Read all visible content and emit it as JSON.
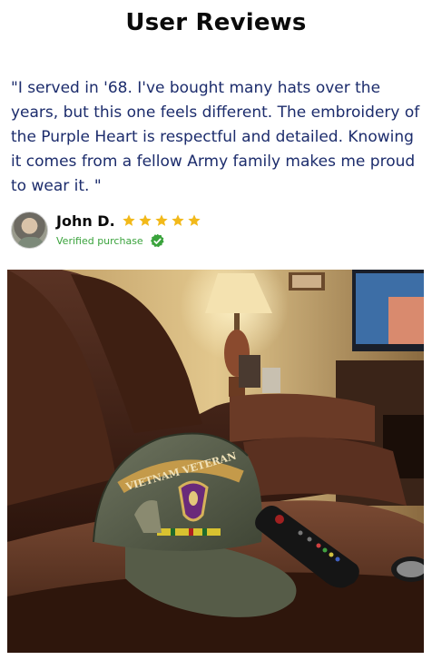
{
  "section": {
    "title": "User Reviews"
  },
  "review": {
    "quote": "\"I served in '68. I've bought many hats over the years, but this one feels different. The embroidery of the Purple Heart is respectful and detailed. Knowing it comes from a fellow Army family makes me proud to wear it. \"",
    "reviewer_name": "John D.",
    "rating": 5,
    "verified_label": "Verified purchase",
    "cap_text": "VIETNAM VETERAN"
  },
  "colors": {
    "quote_text": "#1c2c6c",
    "star": "#f2b91a",
    "verified": "#3aa33c"
  },
  "icons": [
    "user-avatar",
    "star-icon",
    "verified-check-icon"
  ]
}
